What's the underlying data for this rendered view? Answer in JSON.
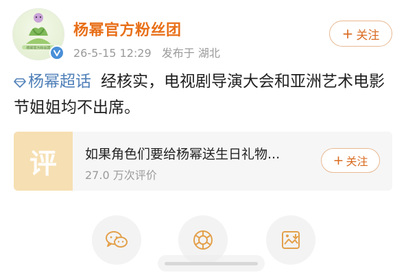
{
  "account": {
    "name": "杨幂官方粉丝团",
    "timestamp": "26-5-15 12:29",
    "location": "发布于 湖北",
    "verified": true,
    "follow_label": "关注"
  },
  "post": {
    "topic": "杨幂超话",
    "text": "经核实，电视剧导演大会和亚洲艺术电影节姐姐均不出席。"
  },
  "review_card": {
    "icon_char": "评",
    "title": "如果角色们要给杨幂送生日礼物...",
    "count": "27.0 万次评价",
    "follow_label": "关注"
  },
  "share": {
    "icons": [
      "wechat-icon",
      "moments-icon",
      "save-image-icon"
    ]
  },
  "colors": {
    "accent": "#e86f18",
    "follow_border": "#e8b892",
    "topic_blue": "#4e7fb8",
    "review_icon_bg": "#f6dfb2",
    "verified_blue": "#4a8fd8",
    "share_icon": "#e3a04a"
  }
}
